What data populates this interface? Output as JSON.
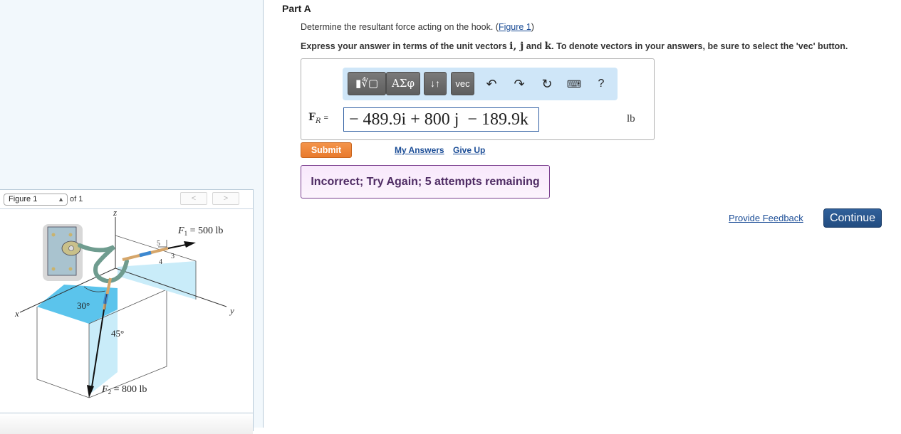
{
  "part": {
    "title": "Part A",
    "question_text": "Determine the resultant force acting on the hook. (",
    "figure_link": "Figure 1",
    "question_close": ")",
    "instructions_pre": "Express your answer in terms of the unit vectors ",
    "unit_vectors": "i, j",
    "instructions_and": " and ",
    "unit_k": "k",
    "instructions_post": ". To denote vectors in your answers, be sure to select the 'vec' button."
  },
  "toolbar": {
    "template_label": "▮∜▢",
    "symbols_label": "ΑΣφ",
    "sort_label": "↓↑",
    "vec_label": "vec",
    "undo_icon": "undo-icon",
    "redo_icon": "redo-icon",
    "reset_icon": "reset-icon",
    "keyboard_icon": "keyboard-icon",
    "help_label": "?"
  },
  "answer": {
    "label_main": "F",
    "label_sub": "R",
    "label_eq": "=",
    "value": "− 489.9i + 800 j  − 189.9k",
    "unit": "lb"
  },
  "actions": {
    "submit": "Submit",
    "my_answers": "My Answers",
    "give_up": "Give Up"
  },
  "feedback": {
    "message": "Incorrect; Try Again; 5 attempts remaining",
    "provide_feedback": "Provide Feedback",
    "continue": "Continue"
  },
  "figure_panel": {
    "selected": "Figure 1",
    "of_label": "of 1",
    "prev": "<",
    "next": ">",
    "figure": {
      "axis_x": "x",
      "axis_y": "y",
      "axis_z": "z",
      "f1_label": "F",
      "f1_sub": "1",
      "f1_value": " = 500 lb",
      "f2_label": "F",
      "f2_sub": "2",
      "f2_value": " = 800 lb",
      "angle_30": "30°",
      "angle_45": "45°",
      "slope_5": "5",
      "slope_3": "3",
      "slope_4": "4"
    }
  }
}
